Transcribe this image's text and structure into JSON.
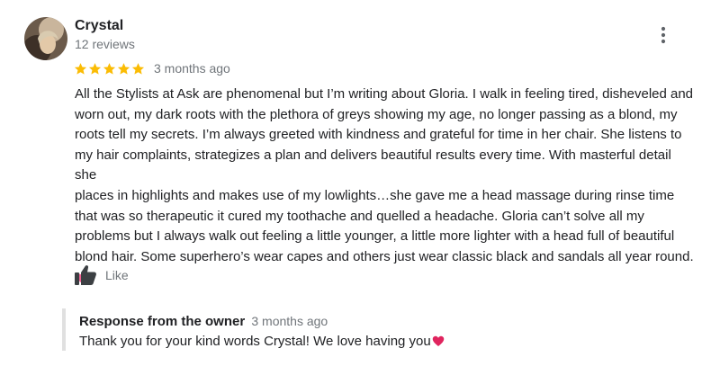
{
  "review": {
    "reviewer_name": "Crystal",
    "reviewer_meta": "12 reviews",
    "rating": 5,
    "date": "3 months ago",
    "text_lines": [
      "All the Stylists at Ask are phenomenal but I’m writing about Gloria. I walk in feeling tired, disheveled and",
      "worn out, my dark roots with the plethora of greys showing my age, no longer passing as a blond, my",
      "roots tell my secrets. I’m always greeted with kindness and grateful for time in her chair. She listens to",
      "my hair complaints, strategizes a plan and delivers beautiful results every time. With masterful detail she",
      "places in highlights and makes use of my lowlights…she gave me a head massage during rinse time",
      "that was so therapeutic  it cured my toothache and quelled a headache. Gloria can’t solve all my",
      "problems but I always walk out feeling a little younger, a little more lighter with a head full of beautiful",
      "blond hair. Some superhero’s wear capes and others just wear classic black and sandals all year round."
    ],
    "trailing_emoji": "sparkling-heart-icon",
    "like_label": "Like"
  },
  "owner_response": {
    "title": "Response from the owner",
    "date": "3 months ago",
    "text": "Thank you for your kind words Crystal! We love having you",
    "trailing_emoji": "red-heart-icon"
  },
  "colors": {
    "star": "#fbbc04",
    "meta_gray": "#70757a",
    "text": "#202124",
    "response_border": "#e0e0e0",
    "heart_red": "#e0245e",
    "heart_pink": "#f06292"
  }
}
